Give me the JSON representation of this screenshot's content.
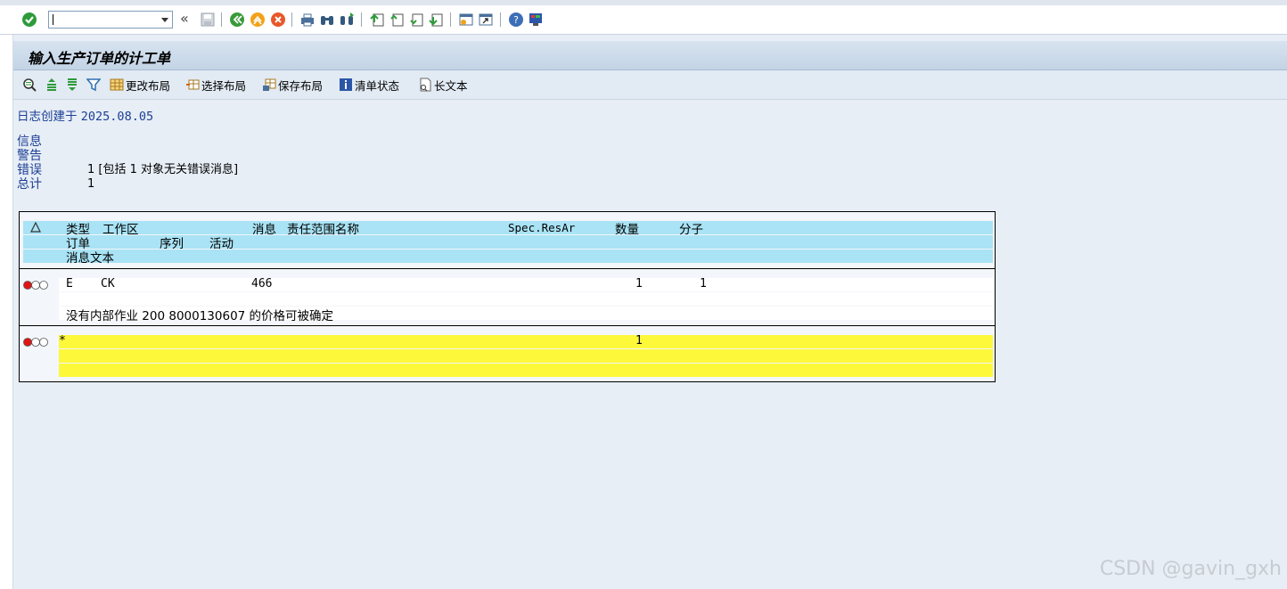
{
  "toolbar": {
    "command_value": "",
    "icons": [
      "enter-icon",
      "back-double-chevron-icon",
      "save-icon",
      "back-icon",
      "exit-icon",
      "cancel-icon",
      "print-icon",
      "find-icon",
      "find-next-icon",
      "first-page-icon",
      "previous-page-icon",
      "next-page-icon",
      "last-page-icon",
      "create-session-icon",
      "shortcut-icon",
      "help-icon",
      "customize-layout-icon"
    ]
  },
  "title": "输入生产订单的计工单",
  "app_toolbar": {
    "details_icon": "details-icon",
    "sort_asc_icon": "sort-ascending-icon",
    "sort_desc_icon": "sort-descending-icon",
    "filter_icon": "filter-icon",
    "change_layout": "更改布局",
    "select_layout": "选择布局",
    "save_layout": "保存布局",
    "list_status": "清单状态",
    "long_text": "长文本"
  },
  "log": {
    "created_label": "日志创建于",
    "created_date": "2025.08.05"
  },
  "summary": {
    "info_label": "信息",
    "warning_label": "警告",
    "error_label": "错误",
    "error_value": "1 [包括 1 对象无关错误消息]",
    "total_label": "总计",
    "total_value": "1"
  },
  "grid": {
    "header_icon": "warning-triangle-icon",
    "header_row1": {
      "type": "类型",
      "work_center": "工作区",
      "message": "消息",
      "resp_area": "责任范围名称",
      "spec_resar": "Spec.ResAr",
      "quantity": "数量",
      "numerator": "分子"
    },
    "header_row2": {
      "order": "订单",
      "sequence": "序列",
      "activity": "活动"
    },
    "header_row3": {
      "message_text": "消息文本"
    },
    "rows": [
      {
        "type": "E",
        "work_center": "CK",
        "message": "466",
        "quantity": "1",
        "numerator": "1",
        "text": "没有内部作业 200 8000130607 的价格可被确定",
        "status": "error"
      },
      {
        "type": "*",
        "quantity": "1",
        "status": "error"
      }
    ]
  },
  "watermark": "CSDN @gavin_gxh",
  "colors": {
    "header_cyan": "#a9e3f5",
    "total_yellow": "#fdf83a",
    "error_red": "#e21414"
  }
}
